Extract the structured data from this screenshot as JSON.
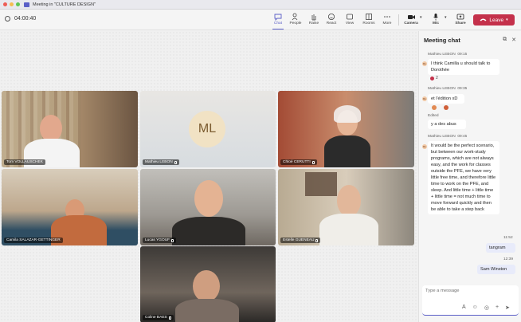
{
  "window": {
    "title": "Meeting in \"CULTURE DESIGN\""
  },
  "toolbar": {
    "timer": "04:00:40",
    "buttons": [
      {
        "label": "Chat",
        "icon": "chat-icon"
      },
      {
        "label": "People",
        "icon": "people-icon",
        "badge": "7"
      },
      {
        "label": "Raise",
        "icon": "raise-hand-icon"
      },
      {
        "label": "React",
        "icon": "react-icon"
      },
      {
        "label": "View",
        "icon": "view-icon"
      },
      {
        "label": "Rooms",
        "icon": "rooms-icon"
      },
      {
        "label": "More",
        "icon": "more-icon"
      }
    ],
    "camera_label": "Camera",
    "mic_label": "Mic",
    "share_label": "Share",
    "leave_label": "Leave"
  },
  "participants": [
    {
      "name": "Tom VOLLAUSCHEK",
      "muted": false
    },
    {
      "name": "Mathieu LEBON",
      "initials": "ML",
      "muted": true
    },
    {
      "name": "Chloé CERUTTI",
      "muted": true
    },
    {
      "name": "Camila SALAZAR-GETTINGER",
      "muted": false
    },
    {
      "name": "Lucas YGOUF",
      "muted": true
    },
    {
      "name": "Estelle GUENEAU",
      "muted": true
    },
    {
      "name": "Coline BAES",
      "muted": true
    }
  ],
  "chat": {
    "title": "Meeting chat",
    "messages": [
      {
        "sender": "Mathieu LEBON",
        "time": "09:15",
        "text": "I think Camilla u should talk to Dorothée",
        "reaction_count": "2"
      },
      {
        "sender": "Mathieu LEBON",
        "time": "09:35",
        "text": "et l'édition xD",
        "edited_label": "Edited",
        "text2": "y a des abus"
      },
      {
        "sender": "Mathieu LEBON",
        "time": "09:45",
        "text": "It would be the perfect scenario, but between our work-study programs, which are not always easy, and the work for classes outside the PFE, we have very little free time, and therefore little time to work on the PFE, and sleep. And little time + little time + little time = not much time to move forward quickly and then be able to take a step back"
      },
      {
        "sender": "me",
        "time": "11:52",
        "text": "tangram"
      },
      {
        "sender": "me",
        "time": "12:39",
        "text": "Sam Winston"
      }
    ],
    "compose_placeholder": "Type a message"
  },
  "colors": {
    "accent": "#5b5fc7",
    "leave": "#c4314b",
    "chat_bg": "#f5f5f5"
  }
}
